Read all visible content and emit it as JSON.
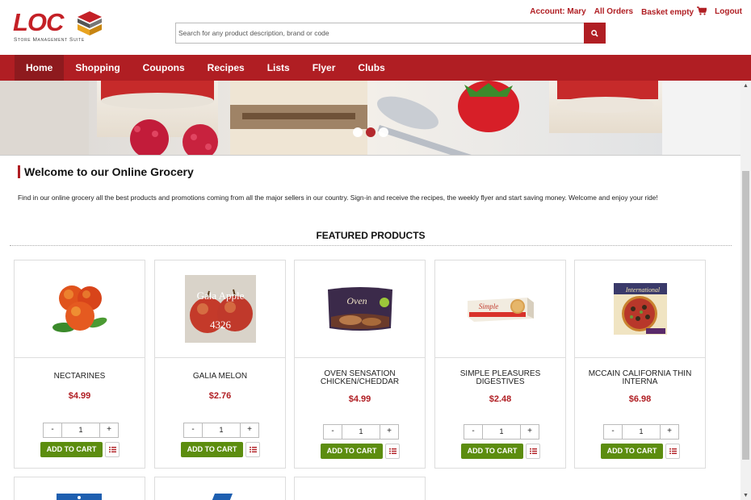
{
  "brand": {
    "logo_text": "LOC",
    "tagline": "Store Management Suite"
  },
  "header": {
    "search_placeholder": "Search for any product description, brand or code",
    "account": "Account: Mary",
    "orders": "All Orders",
    "basket": "Basket empty",
    "logout": "Logout"
  },
  "nav": [
    "Home",
    "Shopping",
    "Coupons",
    "Recipes",
    "Lists",
    "Flyer",
    "Clubs"
  ],
  "welcome": {
    "title": "Welcome to our Online Grocery",
    "text": "Find in our online grocery all the best products and promotions coming from all the major sellers in our country. Sign-in and receive the recipes, the weekly flyer and start saving money. Welcome and enjoy your ride!"
  },
  "featured_title": "FEATURED PRODUCTS",
  "products": [
    {
      "name": "NECTARINES",
      "price": "$4.99",
      "qty": "1"
    },
    {
      "name": "GALIA MELON",
      "price": "$2.76",
      "qty": "1",
      "img_text_1": "Gala Apple",
      "img_text_2": "4326"
    },
    {
      "name": "OVEN SENSATION CHICKEN/CHEDDAR",
      "price": "$4.99",
      "qty": "1",
      "img_text": "Oven"
    },
    {
      "name": "SIMPLE PLEASURES DIGESTIVES",
      "price": "$2.48",
      "qty": "1",
      "img_text": "Simple"
    },
    {
      "name": "MCCAIN CALIFORNIA THIN INTERNA",
      "price": "$6.98",
      "qty": "1",
      "img_text": "International"
    }
  ],
  "buttons": {
    "minus": "-",
    "plus": "+",
    "add_to_cart": "ADD TO CART"
  },
  "colors": {
    "brand_red": "#b01e23",
    "cart_green": "#5c8d0f"
  }
}
